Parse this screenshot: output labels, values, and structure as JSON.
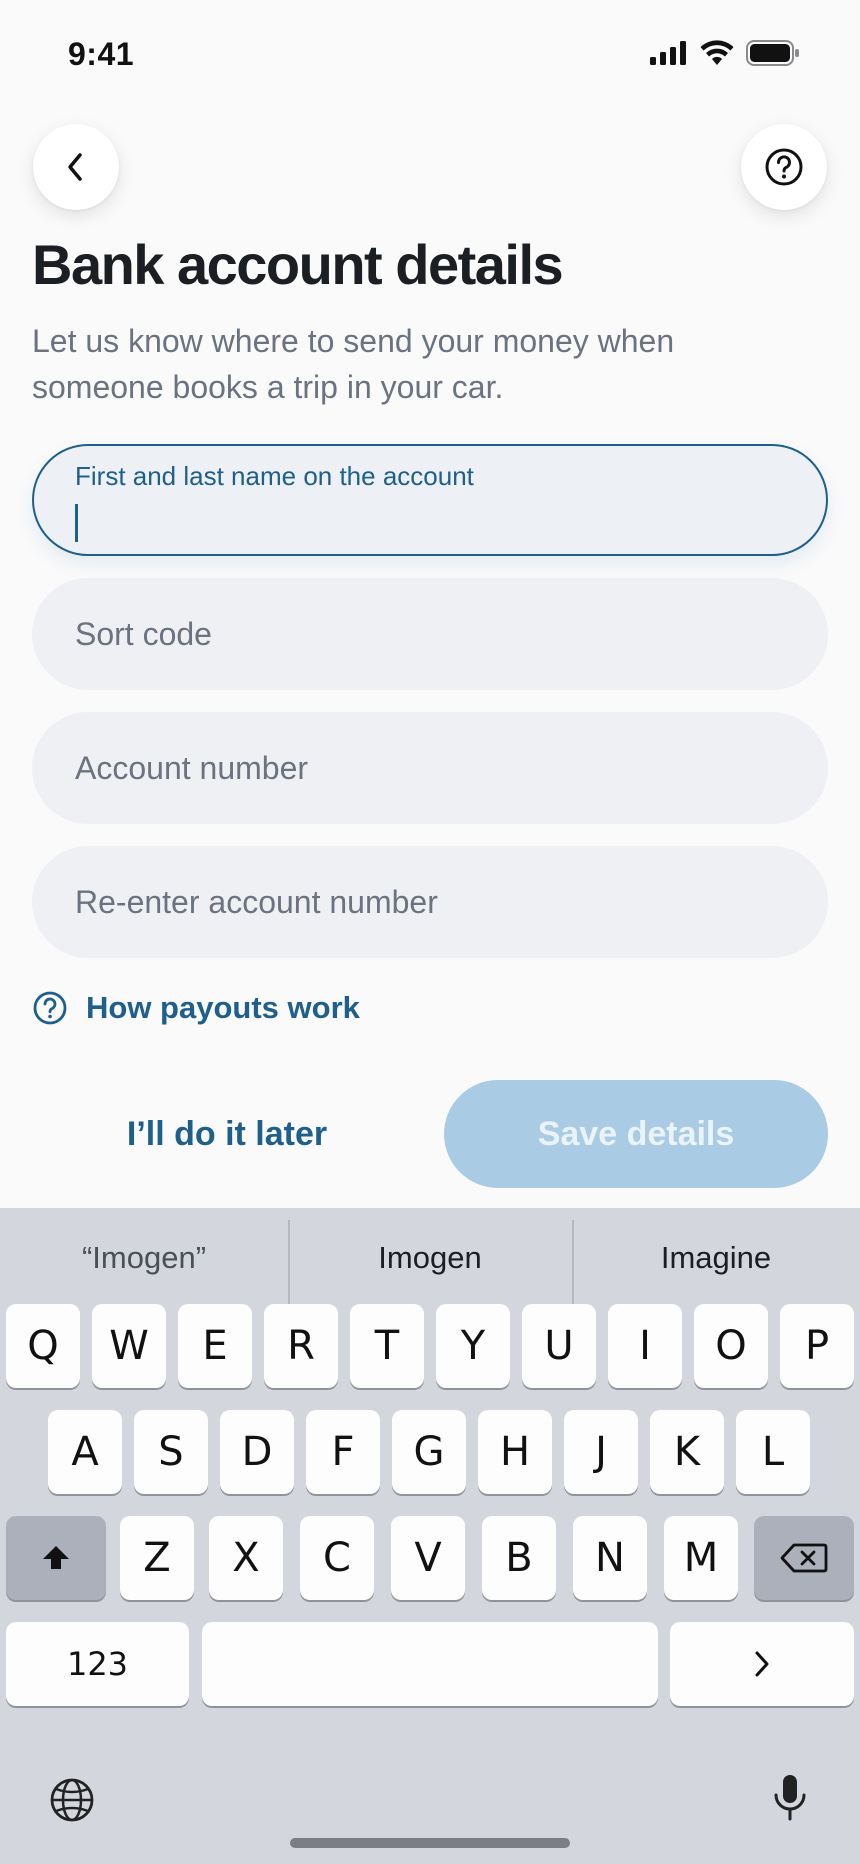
{
  "status_bar": {
    "time": "9:41"
  },
  "header": {
    "back_icon": "chevron-left-icon",
    "help_icon": "question-circle-icon"
  },
  "page": {
    "title": "Bank account details",
    "subtitle": "Let us know where to send your money when someone books a trip in your car."
  },
  "form": {
    "name_label": "First and last name on the account",
    "name_value": "",
    "sort_code_placeholder": "Sort code",
    "account_number_placeholder": "Account number",
    "reenter_account_placeholder": "Re-enter account number"
  },
  "links": {
    "payouts": "How payouts work"
  },
  "actions": {
    "later": "I’ll do it later",
    "save": "Save details"
  },
  "colors": {
    "accent": "#1e5f8c",
    "save_disabled": "#a9cbe4",
    "field_bg": "#eef0f4"
  },
  "keyboard": {
    "suggestions": [
      "“Imogen”",
      "Imogen",
      "Imagine"
    ],
    "row1": [
      "Q",
      "W",
      "E",
      "R",
      "T",
      "Y",
      "U",
      "I",
      "O",
      "P"
    ],
    "row2": [
      "A",
      "S",
      "D",
      "F",
      "G",
      "H",
      "J",
      "K",
      "L"
    ],
    "row3": [
      "Z",
      "X",
      "C",
      "V",
      "B",
      "N",
      "M"
    ],
    "numbers_key": "123",
    "return_key_icon": "chevron-right-icon",
    "shift_icon": "shift-icon",
    "delete_icon": "backspace-icon",
    "globe_icon": "globe-icon",
    "mic_icon": "microphone-icon"
  }
}
